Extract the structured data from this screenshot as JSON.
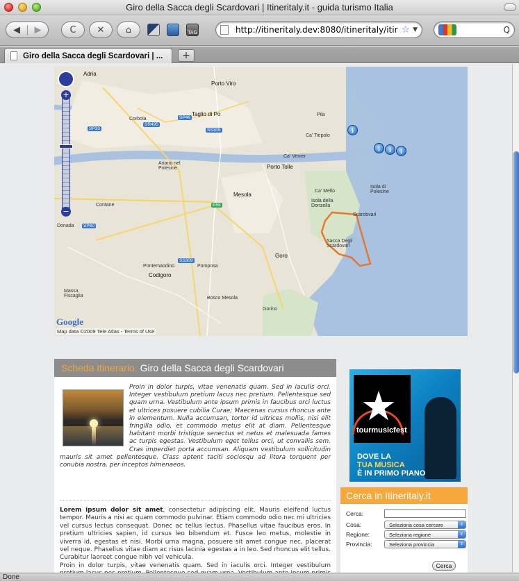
{
  "window": {
    "title": "Giro della Sacca degli Scardovari | Itineritaly.it - guida turismo Italia"
  },
  "toolbar": {
    "back_glyph": "◀",
    "forward_glyph": "▶",
    "reload_glyph": "C",
    "stop_glyph": "✕",
    "home_glyph": "⌂",
    "tag_label": "TAG",
    "url": "http://itineritaly.dev:8080/itineritaly/itir",
    "search_glyph": "Q"
  },
  "tabs": [
    {
      "label": "Giro della Sacca degli Scardovari | ..."
    }
  ],
  "newtab_label": "+",
  "status": {
    "text": "Done"
  },
  "map": {
    "copyright": "Map data ©2009 Tele Atlas - Terms of Use",
    "brand": "Google",
    "labels": [
      {
        "text": "Adria"
      },
      {
        "text": "Porto Viro"
      },
      {
        "text": "Taglio di Po"
      },
      {
        "text": "Corbola"
      },
      {
        "text": "Ariano nel Polesine"
      },
      {
        "text": "Porto Tolle"
      },
      {
        "text": "Mesola"
      },
      {
        "text": "Isola della Donzella"
      },
      {
        "text": "Sacca Degli Scardovari"
      },
      {
        "text": "Goro"
      },
      {
        "text": "Codigoro"
      },
      {
        "text": "Massa Fiscaglia"
      },
      {
        "text": "Pontemaodino"
      },
      {
        "text": "Pomposa"
      },
      {
        "text": "Isola di Polesine"
      },
      {
        "text": "Ca' Venier"
      },
      {
        "text": "Ca' Mello"
      },
      {
        "text": "Scardovari"
      },
      {
        "text": "Gorino"
      },
      {
        "text": "Bosco Mesola"
      },
      {
        "text": "Contane"
      },
      {
        "text": "Ca' Tiepolo"
      },
      {
        "text": "Donada"
      },
      {
        "text": "Pila"
      }
    ],
    "shields": [
      "SP33",
      "SR495",
      "SP46",
      "SS309",
      "E55",
      "SP60",
      "SS309"
    ],
    "pins": [
      "i",
      "i",
      "i",
      "i"
    ],
    "zoom_plus": "+",
    "zoom_minus": "−"
  },
  "itinerary": {
    "prefix": "Scheda Itinerario.",
    "title": "Giro della Sacca degli Scardovari",
    "intro": "Proin in dolor turpis, vitae venenatis quam. Sed in iaculis orci. Integer vestibulum pretium lacus nec pretium. Pellentesque sed quam urna. Vestibulum ante ipsum primis in faucibus orci luctus et ultrices posuere cubilia Curae; Maecenas cursus rhoncus ante in elementum. Nulla accumsan, tortor id ultrices mollis, nisi elit fringilla odio, et commodo metus elit at diam. Pellentesque habitant morbi tristique senectus et netus et malesuada fames ac turpis egestas. Vestibulum eget tellus orci, ut convallis sem. Cras imperdiet porta accumsan. Aliquam vestibulum sollicitudin mauris sit amet pellentesque. Class aptent taciti sociosqu ad litora torquent per conubia nostra, per inceptos himenaeos.",
    "body_lead": "Lorem ipsum dolor sit amet",
    "body_rest": ", consectetur adipiscing elit. Mauris eleifend luctus tempor. Mauris a nisi ac quam commodo pulvinar. Etiam commodo odio nec mi ultricies vel cursus lectus consequat. Donec ac tellus lectus. Phasellus vitae faucibus eros. In pretium ultricies sapien, id cursus leo bibendum et. Fusce leo metus, molestie in viverra id, egestas et nisi. Morbi urna magna, posuere sit amet congue nec, placerat vel neque. Phasellus vitae diam ac risus lacinia egestas a in leo. Sed rhoncus elit tellus. Curabitur laoreet congue nibh vel vehicula.",
    "body_p2": "Proin in dolor turpis, vitae venenatis quam. Sed in iaculis orci. Integer vestibulum pretium lacus nec pretium. Pellentesque sed quam urna. Vestibulum ante ipsum primis in faucibus"
  },
  "promo": {
    "logo": "tourmusicfest",
    "line1": "DOVE LA",
    "line2": "TUA MUSICA",
    "line3": "È IN PRIMO PIANO"
  },
  "search": {
    "heading": "Cerca in Itineritaly.it",
    "cerca_label": "Cerca:",
    "cerca_value": "",
    "cosa_label": "Cosa:",
    "cosa_value": "Seleziona cosa cercare",
    "regione_label": "Regione:",
    "regione_value": "Seleziona regione",
    "provincia_label": "Provincia:",
    "provincia_value": "Seleziona provincia",
    "button": "Cerca"
  },
  "colors": {
    "accent_orange": "#f6a83d",
    "header_gray": "#8c8c8c",
    "route": "#e8762a"
  }
}
